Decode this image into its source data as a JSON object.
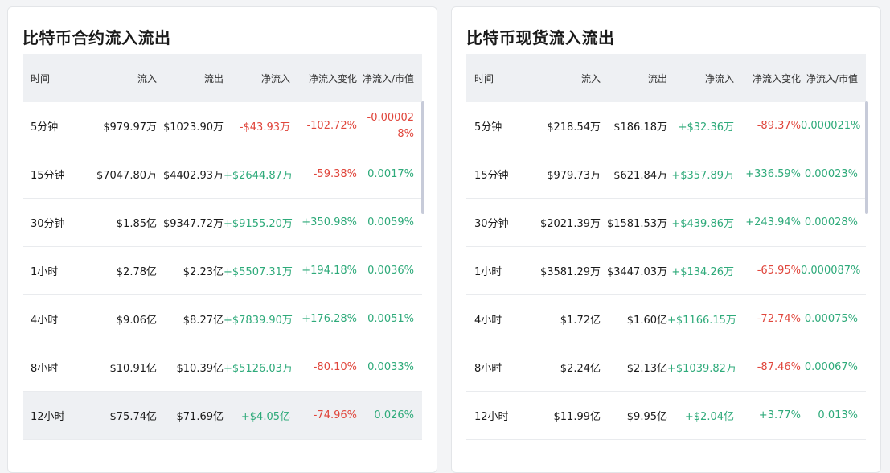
{
  "headers": [
    "时间",
    "流入",
    "流出",
    "净流入",
    "净流入变化",
    "净流入/市值"
  ],
  "panels": [
    {
      "title": "比特币合约流入流出",
      "rows": [
        [
          "5分钟",
          "$979.97万",
          "$1023.90万",
          "-$43.93万",
          "-102.72%",
          "-0.000028%"
        ],
        [
          "15分钟",
          "$7047.80万",
          "$4402.93万",
          "+$2644.87万",
          "-59.38%",
          "0.0017%"
        ],
        [
          "30分钟",
          "$1.85亿",
          "$9347.72万",
          "+$9155.20万",
          "+350.98%",
          "0.0059%"
        ],
        [
          "1小时",
          "$2.78亿",
          "$2.23亿",
          "+$5507.31万",
          "+194.18%",
          "0.0036%"
        ],
        [
          "4小时",
          "$9.06亿",
          "$8.27亿",
          "+$7839.90万",
          "+176.28%",
          "0.0051%"
        ],
        [
          "8小时",
          "$10.91亿",
          "$10.39亿",
          "+$5126.03万",
          "-80.10%",
          "0.0033%"
        ],
        [
          "12小时",
          "$75.74亿",
          "$71.69亿",
          "+$4.05亿",
          "-74.96%",
          "0.026%"
        ]
      ]
    },
    {
      "title": "比特币现货流入流出",
      "rows": [
        [
          "5分钟",
          "$218.54万",
          "$186.18万",
          "+$32.36万",
          "-89.37%",
          "0.000021%"
        ],
        [
          "15分钟",
          "$979.73万",
          "$621.84万",
          "+$357.89万",
          "+336.59%",
          "0.00023%"
        ],
        [
          "30分钟",
          "$2021.39万",
          "$1581.53万",
          "+$439.86万",
          "+243.94%",
          "0.00028%"
        ],
        [
          "1小时",
          "$3581.29万",
          "$3447.03万",
          "+$134.26万",
          "-65.95%",
          "0.000087%"
        ],
        [
          "4小时",
          "$1.72亿",
          "$1.60亿",
          "+$1166.15万",
          "-72.74%",
          "0.00075%"
        ],
        [
          "8小时",
          "$2.24亿",
          "$2.13亿",
          "+$1039.82万",
          "-87.46%",
          "0.00067%"
        ],
        [
          "12小时",
          "$11.99亿",
          "$9.95亿",
          "+$2.04亿",
          "+3.77%",
          "0.013%"
        ]
      ]
    }
  ]
}
